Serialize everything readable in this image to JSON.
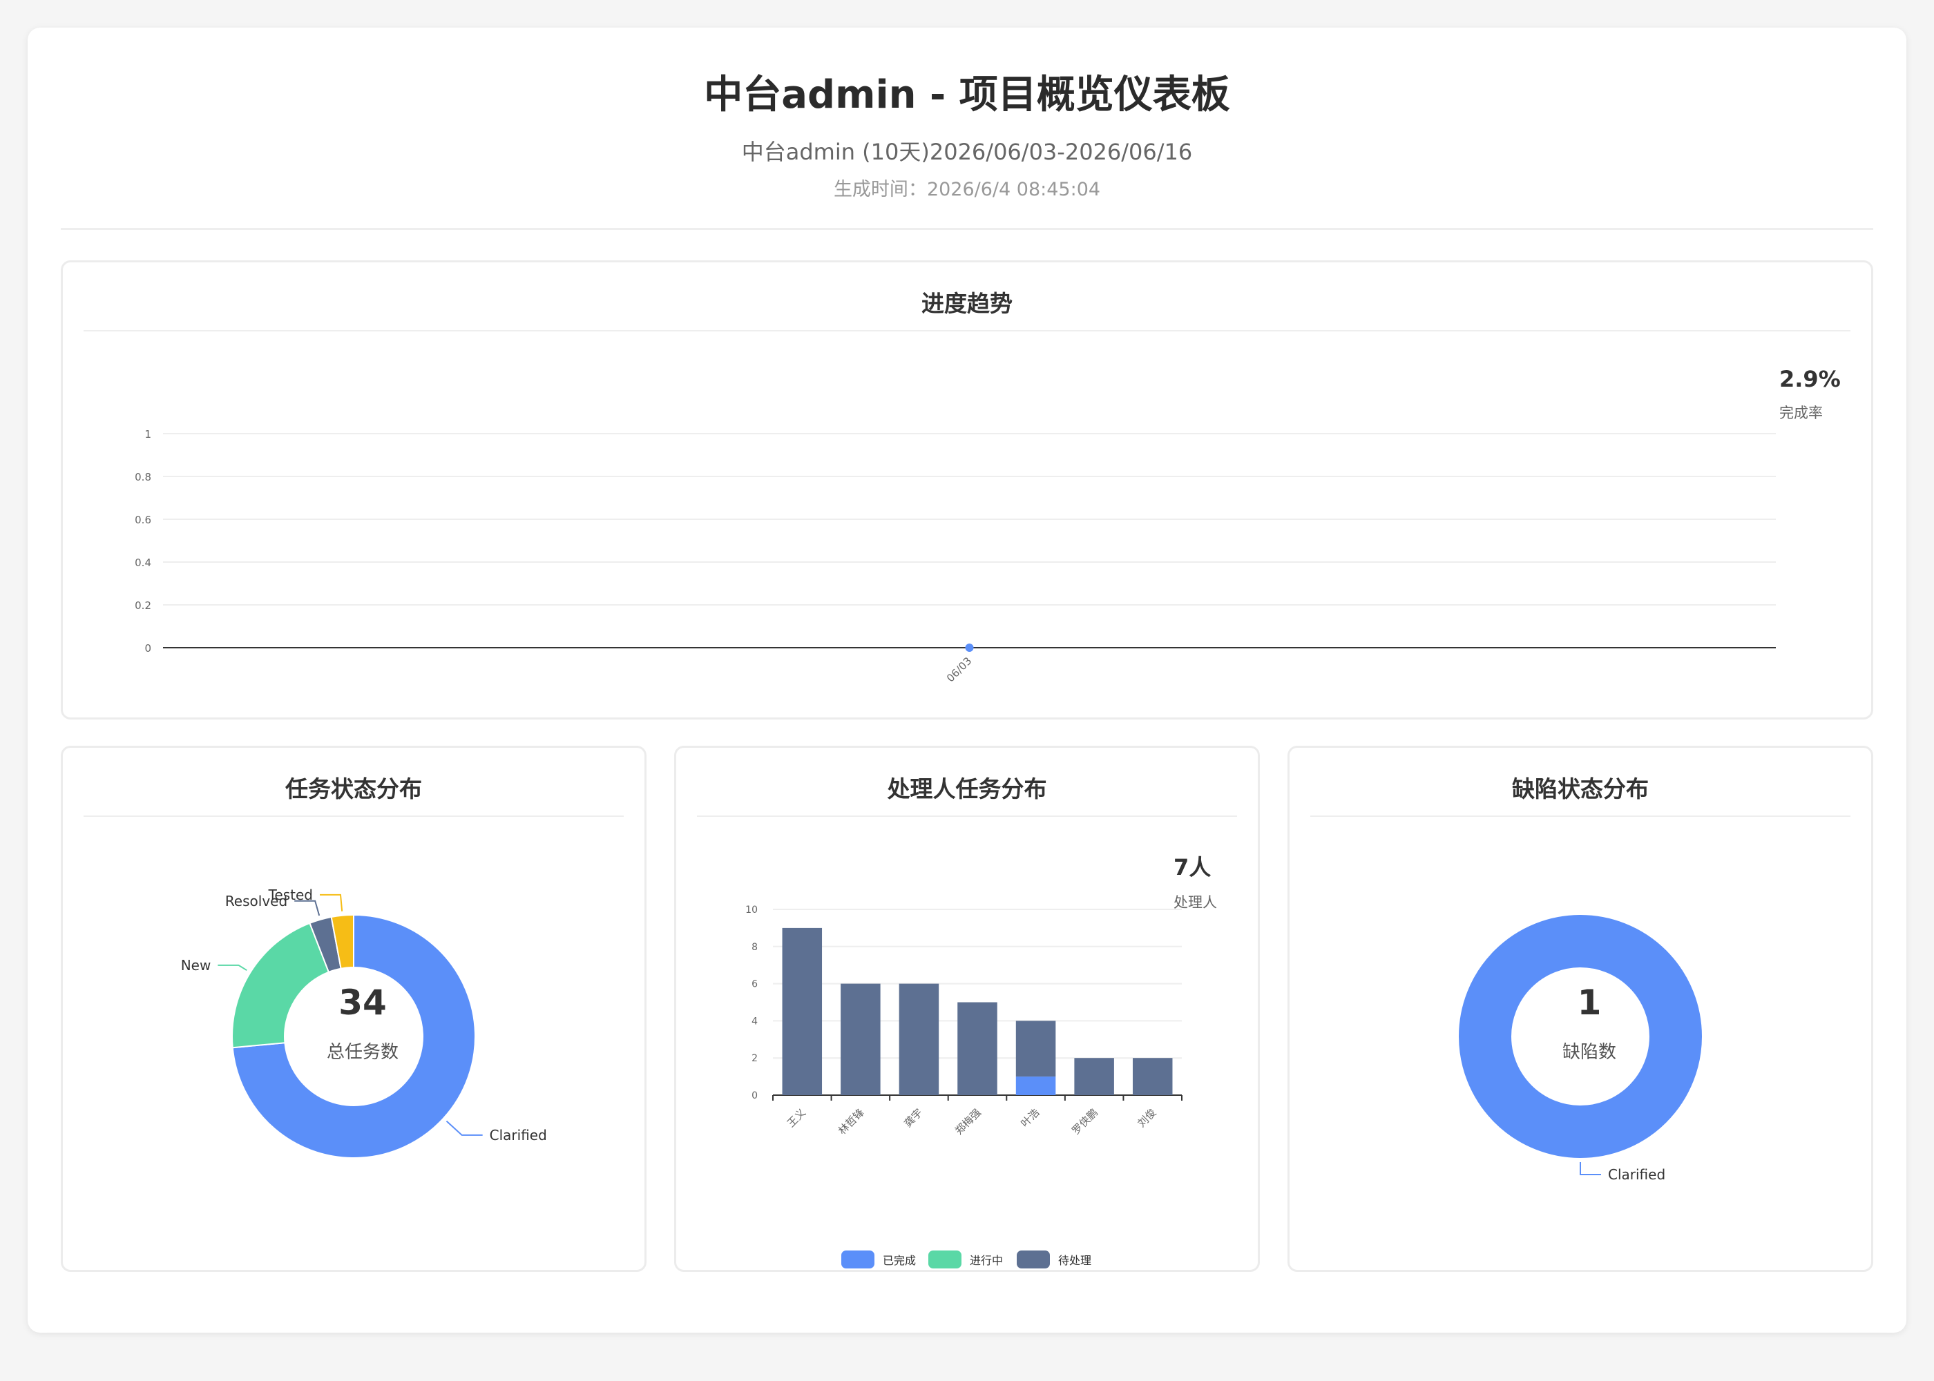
{
  "header": {
    "title": "中台admin - 项目概览仪表板",
    "subtitle": "中台admin (10天)2026/06/03-2026/06/16",
    "generated_label": "生成时间：",
    "generated_value": "2026/6/4 08:45:04"
  },
  "colors": {
    "blue": "#5b8ff9",
    "green": "#5ad8a6",
    "slate": "#5d7092",
    "yellow": "#f6bd16"
  },
  "progress": {
    "title": "进度趋势",
    "stat_value": "2.9%",
    "stat_label": "完成率"
  },
  "task_status": {
    "title": "任务状态分布",
    "center_value": "34",
    "center_label": "总任务数"
  },
  "assignee": {
    "title": "处理人任务分布",
    "stat_value": "7人",
    "stat_label": "处理人"
  },
  "defect": {
    "title": "缺陷状态分布",
    "center_value": "1",
    "center_label": "缺陷数"
  },
  "chart_data": [
    {
      "type": "line",
      "x": [
        "06/03"
      ],
      "series": [
        {
          "values": [
            0
          ]
        }
      ],
      "ylim": [
        0,
        1
      ],
      "yticks": [
        "0",
        "0.2",
        "0.4",
        "0.6",
        "0.8",
        "1"
      ],
      "grid": true
    },
    {
      "type": "pie",
      "categories": [
        "Clarified",
        "New",
        "Resolved",
        "Tested"
      ],
      "values": [
        25,
        7,
        1,
        1
      ],
      "colors": [
        "#5b8ff9",
        "#5ad8a6",
        "#5d7092",
        "#f6bd16"
      ]
    },
    {
      "type": "bar",
      "categories": [
        "王义",
        "林哲锋",
        "龚宇",
        "郑梅强",
        "叶浩",
        "罗侠鹏",
        "刘俊"
      ],
      "series": [
        {
          "name": "已完成",
          "values": [
            0,
            0,
            0,
            0,
            1,
            0,
            0
          ],
          "color": "#5b8ff9"
        },
        {
          "name": "进行中",
          "values": [
            0,
            0,
            0,
            0,
            0,
            0,
            0
          ],
          "color": "#5ad8a6"
        },
        {
          "name": "待处理",
          "values": [
            9,
            6,
            6,
            5,
            3,
            2,
            2
          ],
          "color": "#5d7092"
        }
      ],
      "ylim": [
        0,
        10
      ],
      "yticks": [
        "0",
        "2",
        "4",
        "6",
        "8",
        "10"
      ],
      "legend": "bottom"
    },
    {
      "type": "pie",
      "categories": [
        "Clarified"
      ],
      "values": [
        1
      ],
      "colors": [
        "#5b8ff9"
      ]
    }
  ]
}
